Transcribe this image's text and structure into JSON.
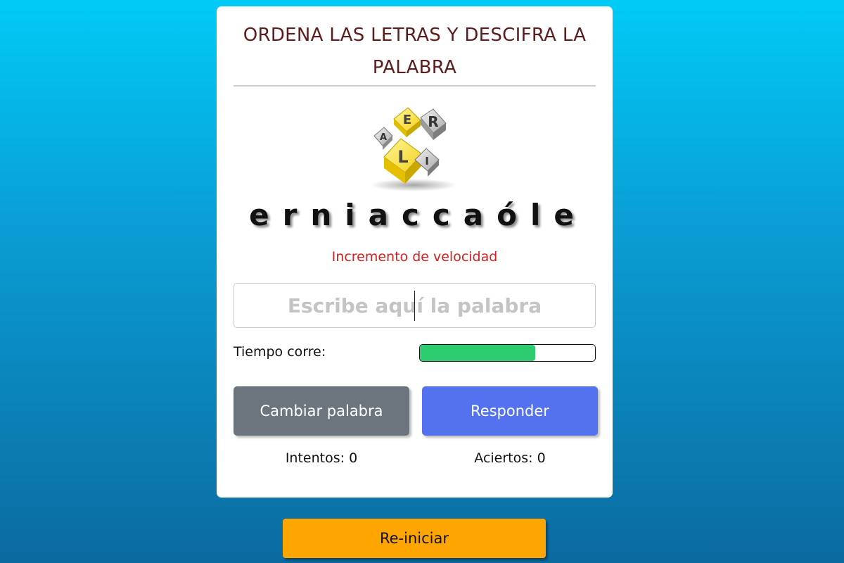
{
  "game": {
    "title": "ORDENA LAS LETRAS Y DESCIFRA LA PALABRA",
    "logo_icon": "letter-tiles-logo-icon",
    "scrambled_word": "erniaccaóle",
    "hint": "Incremento de velocidad"
  },
  "answer_input": {
    "value": "",
    "placeholder": "Escribe aquí la palabra"
  },
  "timer": {
    "label": "Tiempo corre:",
    "remaining_fraction": 0.66,
    "fill_color": "#2ecc71"
  },
  "buttons": {
    "change_label": "Cambiar palabra",
    "answer_label": "Responder",
    "restart_label": "Re-iniciar"
  },
  "stats": {
    "attempts_text": "Intentos: 0",
    "hits_text": "Aciertos: 0"
  },
  "colors": {
    "title": "#5c1d1d",
    "hint": "#d81f1f",
    "change_button": "#6c757d",
    "answer_button": "#5472ef",
    "restart_button": "#ffa500"
  }
}
